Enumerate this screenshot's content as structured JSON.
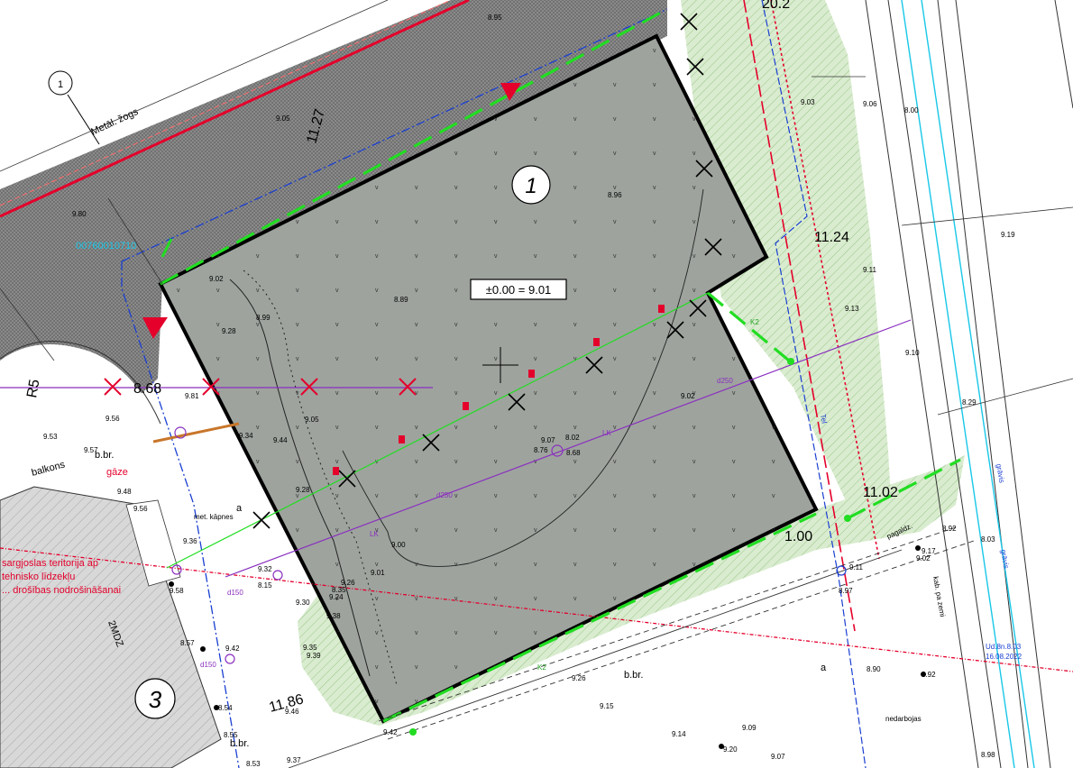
{
  "plan": {
    "building_number": "1",
    "elevation_box": "±0.00 = 9.01",
    "building_3_number": "3",
    "circle_1_label": "1",
    "dims": {
      "d_top": "11.27",
      "d_right": "11.24",
      "d_right2": "11.02",
      "d_left": "8.68",
      "d_bottom": "11.86",
      "d_small": "1.00",
      "d_topright": "20.2"
    },
    "radius_label": "R5",
    "text_labels": {
      "metal_fence": "Metāl. žogs",
      "gaze": "gāze",
      "balkons": "balkons",
      "bbr": "b.br.",
      "met_kapnes": "met. kāpnes",
      "a": "a",
      "cadastre": "00760010710",
      "sargjoslas1": "sargjoslas teritorija ap",
      "sargjoslas2": "tehnisko līdzekļu",
      "sargjoslas3": "... drošības nodrošināšanai",
      "d250": "d250",
      "d150": "d150",
      "lk": "LK",
      "k2": "K2",
      "grāvis": "grāvis",
      "kab": "kab. pa zemi",
      "nedarbojas": "nedarbojas",
      "ud_date": "Ud.8n.8.03",
      "date": "16.08.2022",
      "two_mdz": "2MDZ",
      "tel": "Tel",
      "grāvis2": "grāvis",
      "pagalds": "pagaldz."
    },
    "elevations": [
      "9.02",
      "8.99",
      "8.89",
      "8.96",
      "9.03",
      "9.06",
      "8.00",
      "9.19",
      "9.11",
      "9.13",
      "9.10",
      "8.29",
      "9.02",
      "9.05",
      "9.44",
      "9.28",
      "9.00",
      "9.01",
      "8.76",
      "8.68",
      "9.07",
      "8.02",
      "9.34",
      "9.36",
      "9.58",
      "9.57",
      "9.53",
      "9.56",
      "9.48",
      "8.35",
      "9.38",
      "9.30",
      "9.24",
      "9.26",
      "9.35",
      "9.39",
      "9.46",
      "9.42",
      "9.15",
      "9.26",
      "9.14",
      "9.09",
      "9.20",
      "9.07",
      "8.90",
      "8.92",
      "8.97",
      "9.11",
      "9.17",
      "9.02",
      "8.92",
      "8.03",
      "8.98",
      "8.57",
      "8.54",
      "8.55",
      "8.53",
      "9.56",
      "9.80",
      "9.05",
      "8.95",
      "9.81",
      "9.37",
      "9.32",
      "8.15",
      "9.28",
      "9.42"
    ],
    "colors": {
      "building_fill": "#9ea39e",
      "green_zone": "#c9e5bd",
      "road_hatch": "#6a6a6a",
      "red_line": "#e4002b",
      "green_line": "#22dd22",
      "blue_line": "#1a3fd1",
      "purple_line": "#8a2fbf",
      "cyan_line": "#19c7e8"
    }
  }
}
